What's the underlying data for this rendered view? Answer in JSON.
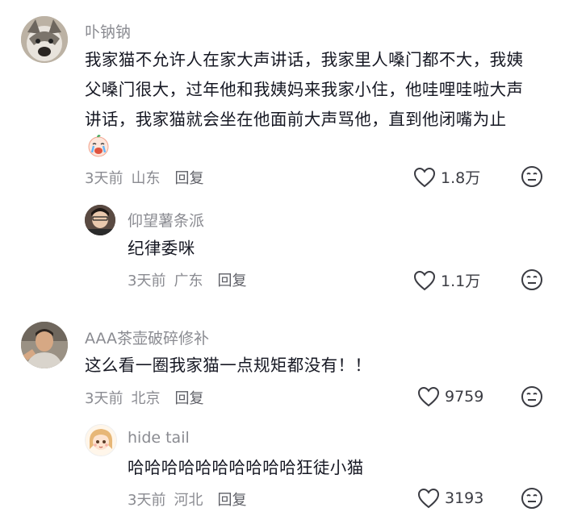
{
  "comments": [
    {
      "username": "卟钠钠",
      "text": "我家猫不允许人在家大声讲话，我家里人嗓门都不大，我姨父嗓门很大，过年他和我姨妈来我家小住，他哇哩哇啦大声讲话，我家猫就会坐在他面前大声骂他，直到他闭嘴为止",
      "time": "3天前",
      "location": "山东",
      "reply_label": "回复",
      "likes": "1.8万"
    },
    {
      "username": "仰望薯条派",
      "text": "纪律委咪",
      "time": "3天前",
      "location": "广东",
      "reply_label": "回复",
      "likes": "1.1万"
    },
    {
      "username": "AAA茶壶破碎修补",
      "text": "这么看一圈我家猫一点规矩都没有！！",
      "time": "3天前",
      "location": "北京",
      "reply_label": "回复",
      "likes": "9759"
    },
    {
      "username": "hide tail",
      "text": "哈哈哈哈哈哈哈哈哈哈狂徒小猫",
      "time": "3天前",
      "location": "河北",
      "reply_label": "回复",
      "likes": "3193"
    }
  ],
  "icons": {
    "like": "heart-outline-icon",
    "dislike": "meh-face-icon",
    "emoji": "crying-face-emoji-icon"
  }
}
